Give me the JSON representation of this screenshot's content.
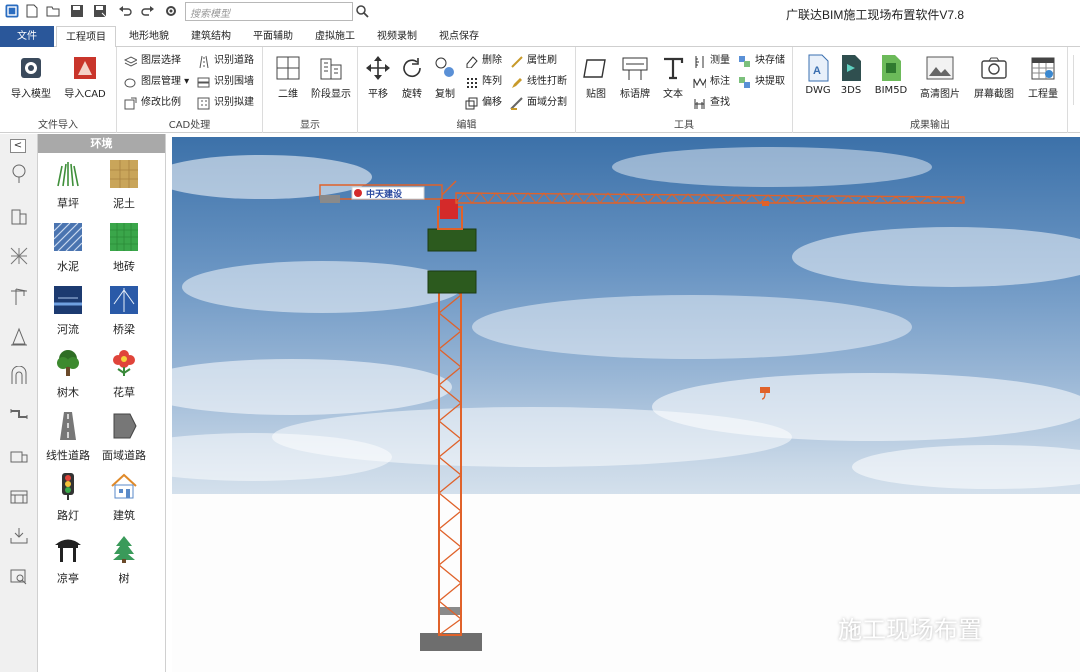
{
  "app": {
    "title": "广联达BIM施工现场布置软件V7.8"
  },
  "search": {
    "placeholder": "搜索模型"
  },
  "menu": {
    "file": "文件",
    "tabs": [
      "工程项目",
      "地形地貌",
      "建筑结构",
      "平面辅助",
      "虚拟施工",
      "视频录制",
      "视点保存"
    ]
  },
  "ribbon": {
    "file_import": {
      "label": "文件导入",
      "import_model": "导入模型",
      "import_cad": "导入CAD"
    },
    "cad": {
      "label": "CAD处理",
      "layer_select": "图层选择",
      "layer_manage": "图层管理",
      "edit_scale": "修改比例",
      "recognize_road": "识别道路",
      "recognize_wall": "识别围墙",
      "recognize_building": "识别拟建"
    },
    "display": {
      "label": "显示",
      "two_d": "二维",
      "phase_display": "阶段显示"
    },
    "edit": {
      "label": "编辑",
      "move": "平移",
      "rotate": "旋转",
      "copy": "复制",
      "delete": "删除",
      "array": "阵列",
      "offset": "偏移",
      "attr_brush": "属性刷",
      "line_break": "线性打断",
      "area_split": "面域分割"
    },
    "tools": {
      "label": "工具",
      "texture": "贴图",
      "slogan_sign": "标语牌",
      "text": "文本",
      "measure": "测量",
      "annotate": "标注",
      "find": "查找",
      "block_save": "块存储",
      "block_extract": "块提取"
    },
    "output": {
      "label": "成果输出",
      "dwg": "DWG",
      "threeds": "3DS",
      "bim5d": "BIM5D",
      "hd_image": "高清图片",
      "screenshot": "屏幕截图",
      "quantity": "工程量"
    }
  },
  "panel": {
    "title": "环境",
    "items": [
      "草坪",
      "泥土",
      "水泥",
      "地砖",
      "河流",
      "桥梁",
      "树木",
      "花草",
      "线性道路",
      "面域道路",
      "路灯",
      "建筑",
      "凉亭",
      "树"
    ]
  },
  "viewport": {
    "crane_brand": "中天建设",
    "watermark": "施工现场布置"
  },
  "colors": {
    "file_tab": "#2a579a",
    "crane": "#e0622a",
    "panel_header": "#a9a9a9"
  }
}
